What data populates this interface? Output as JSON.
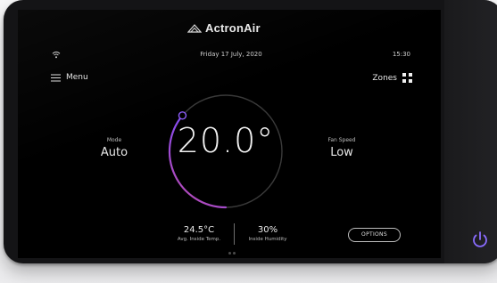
{
  "brand": {
    "name": "ActronAir"
  },
  "status_bar": {
    "date": "Friday 17 July, 2020",
    "time": "15:30"
  },
  "nav": {
    "menu_label": "Menu",
    "zones_label": "Zones"
  },
  "thermostat": {
    "setpoint": "20.0°",
    "dial_fraction": 0.5
  },
  "mode": {
    "label": "Mode",
    "value": "Auto"
  },
  "fan_speed": {
    "label": "Fan Speed",
    "value": "Low"
  },
  "stats": {
    "inside_temp_value": "24.5°C",
    "inside_temp_label": "Avg. Inside Temp.",
    "humidity_value": "30%",
    "humidity_label": "Inside Humidity"
  },
  "options_label": "OPTIONS",
  "icons": [
    "wifi-icon",
    "hamburger-menu-icon",
    "zones-grid-icon",
    "power-icon",
    "actronair-logo-icon"
  ],
  "colors": {
    "accent": "#7a4cff",
    "accent_pink": "#c04aa8",
    "screen_bg": "#000000"
  }
}
